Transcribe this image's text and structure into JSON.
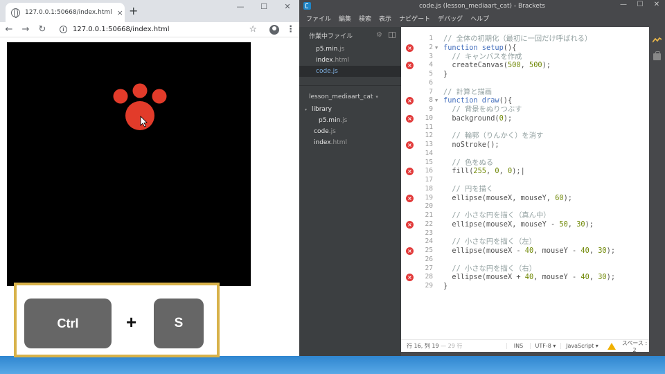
{
  "browser": {
    "tab_title": "127.0.0.1:50668/index.html",
    "tab_close": "×",
    "new_tab": "+",
    "url": "127.0.0.1:50668/index.html",
    "window_controls": {
      "minimize": "—",
      "maximize": "☐",
      "close": "✕"
    },
    "nav": {
      "back": "←",
      "forward": "→",
      "reload": "↻",
      "star": "☆",
      "menu": "⋮"
    }
  },
  "shortcut": {
    "key1": "Ctrl",
    "plus": "+",
    "key2": "S",
    "border_color": "#d8b24a"
  },
  "canvas": {
    "background": "#000000",
    "paw_color": "#e23b2a"
  },
  "editor": {
    "title": "code.js (lesson_mediaart_cat) - Brackets",
    "window_controls": {
      "minimize": "—",
      "maximize": "☐",
      "close": "✕"
    },
    "menu": [
      "ファイル",
      "編集",
      "検索",
      "表示",
      "ナビゲート",
      "デバッグ",
      "ヘルプ"
    ],
    "sidebar": {
      "working_files_label": "作業中ファイル",
      "working_files": [
        {
          "name": "p5.min",
          "ext": ".js",
          "active": false
        },
        {
          "name": "index",
          "ext": ".html",
          "active": false
        },
        {
          "name": "code",
          "ext": ".js",
          "active": true
        }
      ],
      "project_name": "lesson_mediaart_cat",
      "tree": {
        "folder": "library",
        "folder_files": [
          {
            "name": "p5.min",
            "ext": ".js"
          }
        ],
        "files": [
          {
            "name": "code",
            "ext": ".js"
          },
          {
            "name": "index",
            "ext": ".html"
          }
        ]
      }
    },
    "code_lines": [
      {
        "n": "1",
        "err": false,
        "fold": false,
        "tokens": [
          {
            "t": "// 全体の初期化（最初に一回だけ呼ばれる）",
            "c": "c"
          }
        ]
      },
      {
        "n": "2",
        "err": true,
        "fold": true,
        "tokens": [
          {
            "t": "function ",
            "c": "k"
          },
          {
            "t": "setup",
            "c": "k"
          },
          {
            "t": "(){",
            "c": "p"
          }
        ]
      },
      {
        "n": "3",
        "err": false,
        "fold": false,
        "tokens": [
          {
            "t": "  // キャンバスを作成",
            "c": "c"
          }
        ]
      },
      {
        "n": "4",
        "err": true,
        "fold": false,
        "tokens": [
          {
            "t": "  createCanvas(",
            "c": "p"
          },
          {
            "t": "500",
            "c": "n"
          },
          {
            "t": ", ",
            "c": "p"
          },
          {
            "t": "500",
            "c": "n"
          },
          {
            "t": ");",
            "c": "p"
          }
        ]
      },
      {
        "n": "5",
        "err": false,
        "fold": false,
        "tokens": [
          {
            "t": "}",
            "c": "p"
          }
        ]
      },
      {
        "n": "6",
        "err": false,
        "fold": false,
        "tokens": []
      },
      {
        "n": "7",
        "err": false,
        "fold": false,
        "tokens": [
          {
            "t": "// 計算と描画",
            "c": "c"
          }
        ]
      },
      {
        "n": "8",
        "err": true,
        "fold": true,
        "tokens": [
          {
            "t": "function ",
            "c": "k"
          },
          {
            "t": "draw",
            "c": "k"
          },
          {
            "t": "(){",
            "c": "p"
          }
        ]
      },
      {
        "n": "9",
        "err": false,
        "fold": false,
        "tokens": [
          {
            "t": "  // 背景をぬりつぶす",
            "c": "c"
          }
        ]
      },
      {
        "n": "10",
        "err": true,
        "fold": false,
        "tokens": [
          {
            "t": "  background(",
            "c": "p"
          },
          {
            "t": "0",
            "c": "n"
          },
          {
            "t": ");",
            "c": "p"
          }
        ]
      },
      {
        "n": "11",
        "err": false,
        "fold": false,
        "tokens": []
      },
      {
        "n": "12",
        "err": false,
        "fold": false,
        "tokens": [
          {
            "t": "  // 輪郭（りんかく）を消す",
            "c": "c"
          }
        ]
      },
      {
        "n": "13",
        "err": true,
        "fold": false,
        "tokens": [
          {
            "t": "  noStroke();",
            "c": "p"
          }
        ]
      },
      {
        "n": "14",
        "err": false,
        "fold": false,
        "tokens": []
      },
      {
        "n": "15",
        "err": false,
        "fold": false,
        "tokens": [
          {
            "t": "  // 色をぬる",
            "c": "c"
          }
        ]
      },
      {
        "n": "16",
        "err": true,
        "fold": false,
        "tokens": [
          {
            "t": "  fill(",
            "c": "p"
          },
          {
            "t": "255",
            "c": "n"
          },
          {
            "t": ", ",
            "c": "p"
          },
          {
            "t": "0",
            "c": "n"
          },
          {
            "t": ", ",
            "c": "p"
          },
          {
            "t": "0",
            "c": "n"
          },
          {
            "t": ");|",
            "c": "p"
          }
        ]
      },
      {
        "n": "17",
        "err": false,
        "fold": false,
        "tokens": []
      },
      {
        "n": "18",
        "err": false,
        "fold": false,
        "tokens": [
          {
            "t": "  // 円を描く",
            "c": "c"
          }
        ]
      },
      {
        "n": "19",
        "err": true,
        "fold": false,
        "tokens": [
          {
            "t": "  ellipse(mouseX, mouseY, ",
            "c": "p"
          },
          {
            "t": "60",
            "c": "n"
          },
          {
            "t": ");",
            "c": "p"
          }
        ]
      },
      {
        "n": "20",
        "err": false,
        "fold": false,
        "tokens": []
      },
      {
        "n": "21",
        "err": false,
        "fold": false,
        "tokens": [
          {
            "t": "  // 小さな円を描く（真ん中）",
            "c": "c"
          }
        ]
      },
      {
        "n": "22",
        "err": true,
        "fold": false,
        "tokens": [
          {
            "t": "  ellipse(mouseX, mouseY - ",
            "c": "p"
          },
          {
            "t": "50",
            "c": "n"
          },
          {
            "t": ", ",
            "c": "p"
          },
          {
            "t": "30",
            "c": "n"
          },
          {
            "t": ");",
            "c": "p"
          }
        ]
      },
      {
        "n": "23",
        "err": false,
        "fold": false,
        "tokens": []
      },
      {
        "n": "24",
        "err": false,
        "fold": false,
        "tokens": [
          {
            "t": "  // 小さな円を描く（左）",
            "c": "c"
          }
        ]
      },
      {
        "n": "25",
        "err": true,
        "fold": false,
        "tokens": [
          {
            "t": "  ellipse(mouseX - ",
            "c": "p"
          },
          {
            "t": "40",
            "c": "n"
          },
          {
            "t": ", mouseY - ",
            "c": "p"
          },
          {
            "t": "40",
            "c": "n"
          },
          {
            "t": ", ",
            "c": "p"
          },
          {
            "t": "30",
            "c": "n"
          },
          {
            "t": ");",
            "c": "p"
          }
        ]
      },
      {
        "n": "26",
        "err": false,
        "fold": false,
        "tokens": []
      },
      {
        "n": "27",
        "err": false,
        "fold": false,
        "tokens": [
          {
            "t": "  // 小さな円を描く（右）",
            "c": "c"
          }
        ]
      },
      {
        "n": "28",
        "err": true,
        "fold": false,
        "tokens": [
          {
            "t": "  ellipse(mouseX + ",
            "c": "p"
          },
          {
            "t": "40",
            "c": "n"
          },
          {
            "t": ", mouseY - ",
            "c": "p"
          },
          {
            "t": "40",
            "c": "n"
          },
          {
            "t": ", ",
            "c": "p"
          },
          {
            "t": "30",
            "c": "n"
          },
          {
            "t": ");",
            "c": "p"
          }
        ]
      },
      {
        "n": "29",
        "err": false,
        "fold": false,
        "tokens": [
          {
            "t": "}",
            "c": "p"
          }
        ]
      }
    ],
    "status": {
      "position": "行 16, 列 19",
      "line_count": "— 29 行",
      "ins": "INS",
      "encoding": "UTF-8 ▾",
      "language": "JavaScript ▾",
      "spaces": "スペース : 2"
    }
  }
}
